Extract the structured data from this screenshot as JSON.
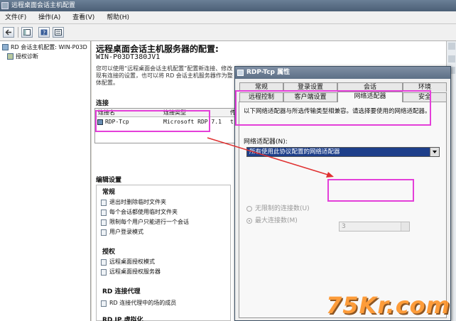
{
  "window": {
    "title": "远程桌面会话主机配置"
  },
  "menu": {
    "items": [
      "文件(F)",
      "操作(A)",
      "查看(V)",
      "帮助(H)"
    ]
  },
  "tree": {
    "items": [
      {
        "label": "RD 会话主机配置: WIN-P03D"
      },
      {
        "label": "授权诊断"
      }
    ]
  },
  "pane": {
    "title": "远程桌面会话主机服务器的配置:",
    "subtitle": "WIN-P03DT380JV1",
    "description": "您可以使用“远程桌面会话主机配置”配置新连接、修改现有连接的设置，也可以将 RD 会话主机服务器作为整体配置。",
    "connections_header": "连接",
    "grid": {
      "columns": [
        "连接名",
        "连接类型",
        "传"
      ],
      "rows": [
        {
          "name": "RDP-Tcp",
          "type": "Microsoft RDP 7.1",
          "extra": "t"
        }
      ]
    },
    "edit_header": "编辑设置",
    "groups": {
      "general": {
        "title": "常规",
        "items": [
          "退出时删除临时文件夹",
          "每个会话都使用临时文件夹",
          "限制每个用户只能进行一个会话",
          "用户登录模式"
        ]
      },
      "licensing": {
        "title": "授权",
        "items": [
          "远程桌面授权模式",
          "远程桌面授权服务器"
        ]
      },
      "broker": {
        "title": "RD 连接代理",
        "items": [
          "RD 连接代理中的场的成员"
        ]
      },
      "ipvirt": {
        "title": "RD IP 虚拟化"
      }
    }
  },
  "dialog": {
    "title": "RDP-Tcp 属性",
    "tabs_row1": [
      "常规",
      "登录设置",
      "会话",
      "环境"
    ],
    "tabs_row2": [
      "远程控制",
      "客户端设置",
      "网络适配器",
      "安全"
    ],
    "info": "以下网络适配器与所选传输类型相兼容。请选择要使用的网络适配器。",
    "adapter_label": "网络适配器(N):",
    "adapter_value": "所有使用此协议配置的网络适配器",
    "radio_unlimited": "无限制的连接数(U)",
    "radio_max": "最大连接数(M)",
    "max_value": "3"
  },
  "watermark": {
    "text": "75Kr.com"
  }
}
